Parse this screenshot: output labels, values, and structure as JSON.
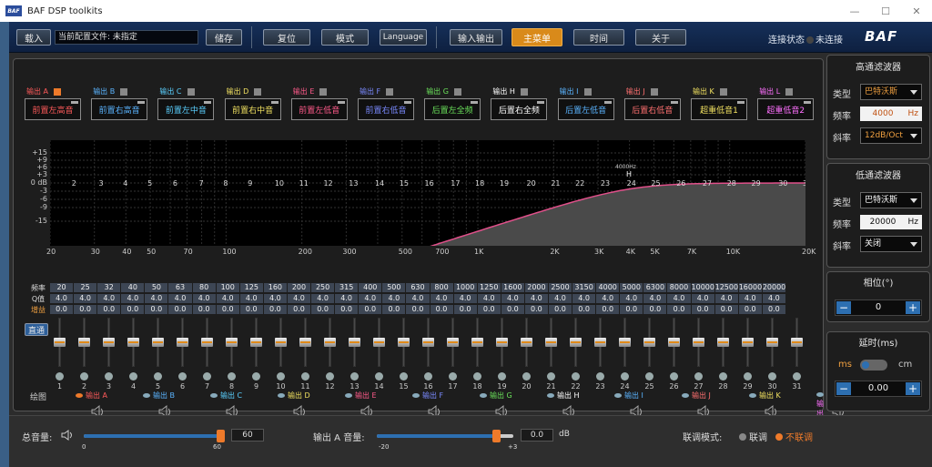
{
  "window": {
    "title": "BAF DSP toolkits",
    "logo": "BAF"
  },
  "toolbar": {
    "load_label": "载入",
    "config_label": "当前配置文件:",
    "config_value": "未指定",
    "save_label": "储存",
    "reset_label": "复位",
    "mode_label": "模式",
    "language_label": "Language",
    "io_label": "输入输出",
    "main_menu_label": "主菜单",
    "time_label": "时间",
    "about_label": "关于",
    "conn_label": "连接状态",
    "conn_value": "未连接",
    "brand": "BAF"
  },
  "outputs": [
    {
      "name": "输出 A",
      "assign": "前置左高音",
      "color": "#ff5a5a",
      "checked": true
    },
    {
      "name": "输出 B",
      "assign": "前置右高音",
      "color": "#5ab4ff",
      "checked": false
    },
    {
      "name": "输出 C",
      "assign": "前置左中音",
      "color": "#5ad0ff",
      "checked": false
    },
    {
      "name": "输出 D",
      "assign": "前置右中音",
      "color": "#f0e060",
      "checked": false
    },
    {
      "name": "输出 E",
      "assign": "前置左低音",
      "color": "#ff5a8a",
      "checked": false
    },
    {
      "name": "输出 F",
      "assign": "前置右低音",
      "color": "#7a8aff",
      "checked": false
    },
    {
      "name": "输出 G",
      "assign": "后置左全频",
      "color": "#6ae05a",
      "checked": false
    },
    {
      "name": "输出 H",
      "assign": "后置右全频",
      "color": "#ffffff",
      "checked": false
    },
    {
      "name": "输出 I",
      "assign": "后置左低音",
      "color": "#5ab4ff",
      "checked": false
    },
    {
      "name": "输出 J",
      "assign": "后置右低音",
      "color": "#ff7070",
      "checked": false
    },
    {
      "name": "输出 K",
      "assign": "超重低音1",
      "color": "#f0e060",
      "checked": false
    },
    {
      "name": "输出 L",
      "assign": "超重低音2",
      "color": "#ff70ff",
      "checked": false
    }
  ],
  "graph": {
    "y_ticks": [
      "+15",
      "+9",
      "+6",
      "+3",
      "0 dB",
      "-3",
      "-6",
      "-9",
      "-15"
    ],
    "band_numbers": [
      "2",
      "3",
      "4",
      "5",
      "6",
      "7",
      "8",
      "9",
      "10",
      "11",
      "12",
      "13",
      "14",
      "15",
      "16",
      "17",
      "18",
      "19",
      "20",
      "21",
      "22",
      "23",
      "24",
      "25",
      "26",
      "27",
      "28",
      "29",
      "30",
      "31"
    ],
    "x_labels": [
      "20",
      "30",
      "40",
      "50",
      "70",
      "100",
      "200",
      "300",
      "500",
      "700",
      "1K",
      "2K",
      "3K",
      "4K",
      "5K",
      "7K",
      "10K",
      "20K"
    ],
    "marker_label": "4000Hz",
    "marker_letter": "H"
  },
  "eq_table": {
    "freq_label": "频率",
    "q_label": "Q值",
    "gain_label": "增益",
    "freqs": [
      "20",
      "25",
      "32",
      "40",
      "50",
      "63",
      "80",
      "100",
      "125",
      "160",
      "200",
      "250",
      "315",
      "400",
      "500",
      "630",
      "800",
      "1000",
      "1250",
      "1600",
      "2000",
      "2500",
      "3150",
      "4000",
      "5000",
      "6300",
      "8000",
      "10000",
      "12500",
      "16000",
      "20000"
    ],
    "q_values": [
      "4.0",
      "4.0",
      "4.0",
      "4.0",
      "4.0",
      "4.0",
      "4.0",
      "4.0",
      "4.0",
      "4.0",
      "4.0",
      "4.0",
      "4.0",
      "4.0",
      "4.0",
      "4.0",
      "4.0",
      "4.0",
      "4.0",
      "4.0",
      "4.0",
      "4.0",
      "4.0",
      "4.0",
      "4.0",
      "4.0",
      "4.0",
      "4.0",
      "4.0",
      "4.0",
      "4.0"
    ],
    "gains": [
      "0.0",
      "0.0",
      "0.0",
      "0.0",
      "0.0",
      "0.0",
      "0.0",
      "0.0",
      "0.0",
      "0.0",
      "0.0",
      "0.0",
      "0.0",
      "0.0",
      "0.0",
      "0.0",
      "0.0",
      "0.0",
      "0.0",
      "0.0",
      "0.0",
      "0.0",
      "0.0",
      "0.0",
      "0.0",
      "0.0",
      "0.0",
      "0.0",
      "0.0",
      "0.0",
      "0.0"
    ]
  },
  "faders": {
    "bypass_label": "直通",
    "numbers": [
      "1",
      "2",
      "3",
      "4",
      "5",
      "6",
      "7",
      "8",
      "9",
      "10",
      "11",
      "12",
      "13",
      "14",
      "15",
      "16",
      "17",
      "18",
      "19",
      "20",
      "21",
      "22",
      "23",
      "24",
      "25",
      "26",
      "27",
      "28",
      "29",
      "30",
      "31"
    ]
  },
  "plot_label": "绘图",
  "highpass": {
    "title": "高通滤波器",
    "type_label": "类型",
    "type_value": "巴特沃斯",
    "freq_label": "频率",
    "freq_value": "4000",
    "freq_unit": "Hz",
    "slope_label": "斜率",
    "slope_value": "12dB/Oct"
  },
  "lowpass": {
    "title": "低通滤波器",
    "type_label": "类型",
    "type_value": "巴特沃斯",
    "freq_label": "频率",
    "freq_value": "20000",
    "freq_unit": "Hz",
    "slope_label": "斜率",
    "slope_value": "关闭"
  },
  "phase": {
    "title": "相位(°)",
    "value": "0",
    "minus": "−",
    "plus": "+"
  },
  "delay": {
    "title": "延时(ms)",
    "ms": "ms",
    "cm": "cm",
    "value": "0.00",
    "minus": "−",
    "plus": "+"
  },
  "footer": {
    "master_label": "总音量:",
    "master_value": "60",
    "master_min": "0",
    "master_max": "60",
    "master_level": 1.0,
    "out_label": "输出 A 音量:",
    "out_value": "0.0",
    "out_unit": "dB",
    "out_min": "-20",
    "out_max": "+3",
    "out_level": 0.87,
    "link_label": "联调模式:",
    "link_on": "联调",
    "link_off": "不联调"
  },
  "colors": {
    "accent": "#ee7a2a",
    "blue": "#2d6fb1",
    "curve": "#e0508a"
  }
}
